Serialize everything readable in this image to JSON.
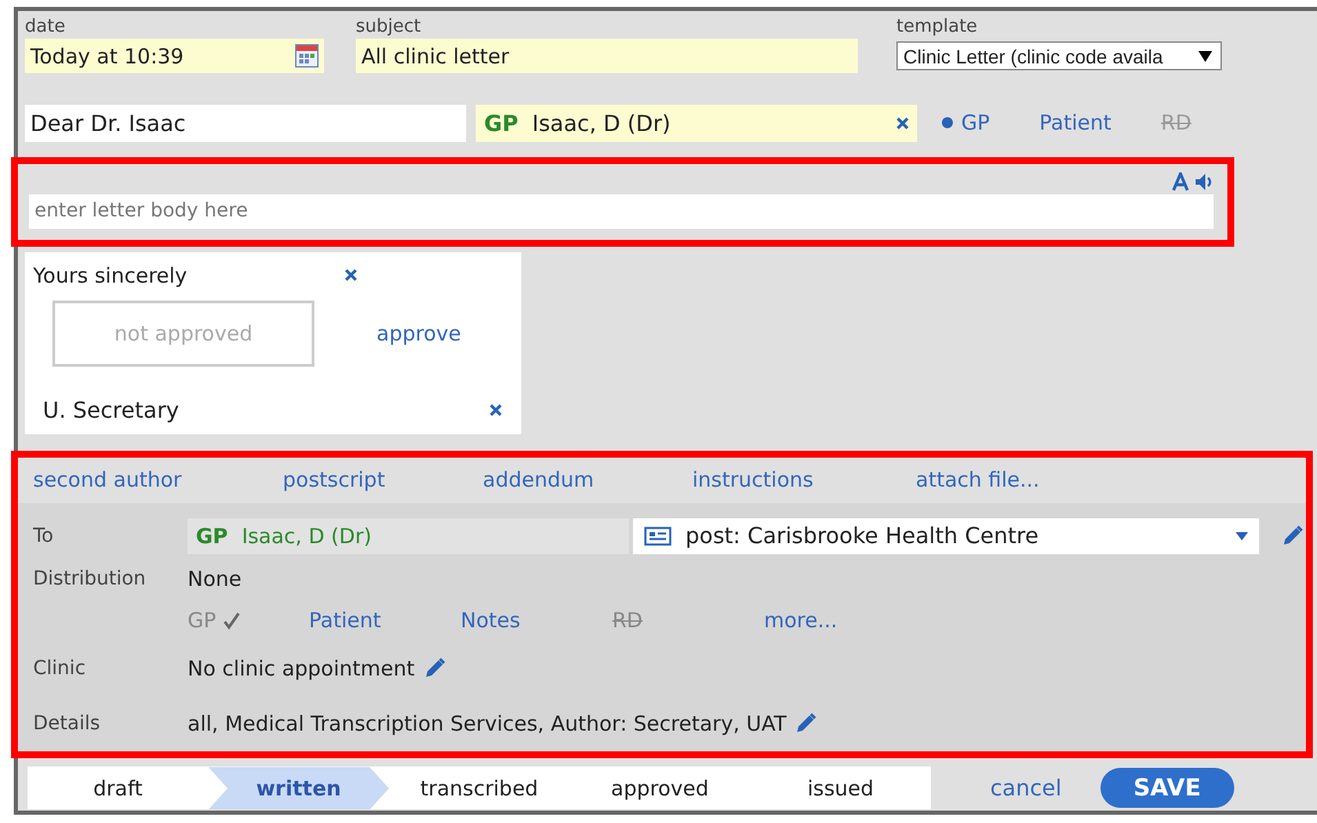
{
  "date": {
    "label": "date",
    "value": "Today at 10:39"
  },
  "subject": {
    "label": "subject",
    "value": "All clinic letter"
  },
  "template": {
    "label": "template",
    "value": "Clinic Letter (clinic code availa"
  },
  "salutation": "Dear Dr. Isaac",
  "recipient": {
    "tag": "GP",
    "name": "Isaac, D (Dr)"
  },
  "recipient_options": [
    {
      "label": "GP",
      "selected": true,
      "disabled": false
    },
    {
      "label": "Patient",
      "selected": false,
      "disabled": false
    },
    {
      "label": "RD",
      "selected": false,
      "disabled": true
    }
  ],
  "body": {
    "placeholder": "enter letter body here",
    "highlighted": true
  },
  "signature": {
    "closing": "Yours sincerely",
    "approval_status": "not approved",
    "approve_link": "approve",
    "signer": "U. Secretary"
  },
  "extras": {
    "highlighted": true,
    "links": [
      "second author",
      "postscript",
      "addendum",
      "instructions",
      "attach file..."
    ]
  },
  "to": {
    "label": "To",
    "tag": "GP",
    "name": "Isaac, D (Dr)",
    "address": "post: Carisbrooke Health Centre"
  },
  "distribution": {
    "label": "Distribution",
    "value": "None",
    "options": [
      {
        "label": "GP",
        "checked": true,
        "disabled": false
      },
      {
        "label": "Patient",
        "checked": false,
        "disabled": false
      },
      {
        "label": "Notes",
        "checked": false,
        "disabled": false
      },
      {
        "label": "RD",
        "checked": false,
        "disabled": true
      },
      {
        "label": "more...",
        "checked": false,
        "disabled": false
      }
    ]
  },
  "clinic": {
    "label": "Clinic",
    "value": "No clinic appointment"
  },
  "details": {
    "label": "Details",
    "value": "all, Medical Transcription Services, Author: Secretary, UAT"
  },
  "workflow": [
    {
      "label": "draft",
      "selected": false
    },
    {
      "label": "written",
      "selected": true
    },
    {
      "label": "transcribed",
      "selected": false
    },
    {
      "label": "approved",
      "selected": false
    },
    {
      "label": "issued",
      "selected": false
    }
  ],
  "actions": {
    "cancel": "cancel",
    "save": "SAVE"
  }
}
